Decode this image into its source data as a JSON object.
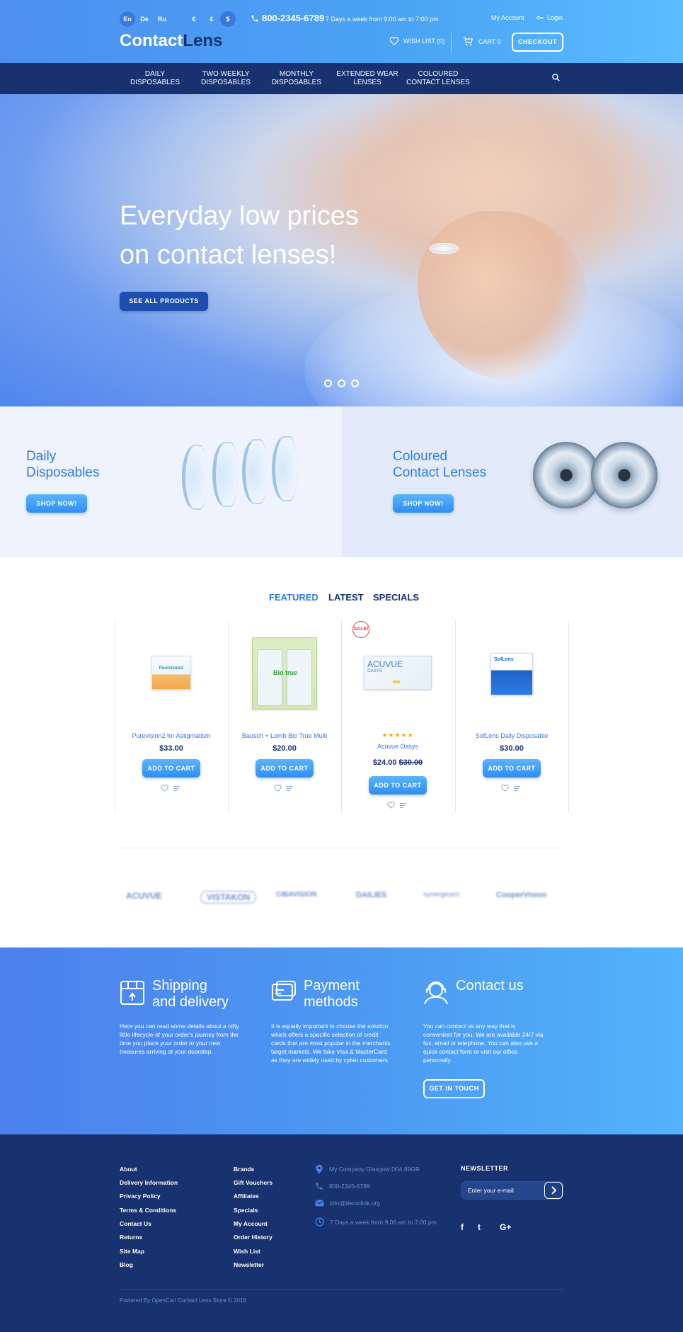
{
  "header": {
    "languages": [
      {
        "label": "En",
        "active": true
      },
      {
        "label": "De",
        "active": false
      },
      {
        "label": "Ru",
        "active": false
      }
    ],
    "currencies": [
      {
        "label": "€",
        "active": false
      },
      {
        "label": "£",
        "active": false
      },
      {
        "label": "$",
        "active": true
      }
    ],
    "phone": "800-2345-6789",
    "hours": "7 Days a week from 9:00 am to 7:00 pm",
    "my_account": "My Account",
    "login": "Login",
    "logo_part1": "Contact",
    "logo_part2": "Lens",
    "wishlist": "WISH LIST (0)",
    "cart": "CART 0",
    "checkout": "CHECKOUT"
  },
  "nav": {
    "items": [
      {
        "line1": "DAILY",
        "line2": "DISPOSABLES"
      },
      {
        "line1": "TWO WEEKLY",
        "line2": "DISPOSABLES"
      },
      {
        "line1": "MONTHLY",
        "line2": "DISPOSABLES"
      },
      {
        "line1": "EXTENDED WEAR",
        "line2": "LENSES"
      },
      {
        "line1": "COLOURED",
        "line2": "CONTACT LENSES"
      }
    ]
  },
  "hero": {
    "line1": "Everyday low prices",
    "line2": "on contact lenses!",
    "button": "SEE ALL PRODUCTS",
    "slides": 3,
    "active_slide": 1
  },
  "promos": [
    {
      "line1": "Daily",
      "line2": "Disposables",
      "button": "SHOP NOW!"
    },
    {
      "line1": "Coloured",
      "line2": "Contact Lenses",
      "button": "SHOP NOW!"
    }
  ],
  "tabs": [
    {
      "label": "FEATURED",
      "active": true
    },
    {
      "label": "LATEST",
      "active": false
    },
    {
      "label": "SPECIALS",
      "active": false
    }
  ],
  "products": [
    {
      "name": "Purevision2 for Astigmatism",
      "price": "$33.00",
      "old_price": "",
      "rating": 0,
      "sale": false,
      "button": "ADD TO CART"
    },
    {
      "name": "Bausch + Lomb Bio True Multi",
      "price": "$20.00",
      "old_price": "",
      "rating": 0,
      "sale": false,
      "button": "ADD TO CART"
    },
    {
      "name": "Acuvue Oasys",
      "price": "$24.00",
      "old_price": "$30.00",
      "rating": 5,
      "sale": true,
      "button": "ADD TO CART"
    },
    {
      "name": "SofLens Daily Disposable",
      "price": "$30.00",
      "old_price": "",
      "rating": 0,
      "sale": false,
      "button": "ADD TO CART"
    }
  ],
  "product_art": {
    "purevision": "PureVision2",
    "biotrue": "Bio true",
    "acuvue": "ACUVUE",
    "acuvue_sub": "OASYS",
    "soflens": "SofLens"
  },
  "sale_badge": "SALE!",
  "stars": "★★★★★",
  "brands": [
    "ACUVUE",
    "VISTAKON",
    "CIBAVISION",
    "DAILIES",
    "synergeyes",
    "CooperVision"
  ],
  "info": [
    {
      "line1": "Shipping",
      "line2": "and delivery",
      "text": "Here you can read some details about a nifty little lifecycle of your order's journey from the time you place your order to your new treasures arriving at your doorstep."
    },
    {
      "line1": "Payment",
      "line2": "methods",
      "text": "It is equally important to choose the solution which offers a specific selection of credit cards that are most popular in the merchants target markets. We take Visa & MasterCard as they are widely used by cyber customers."
    },
    {
      "line1": "Contact us",
      "line2": "",
      "text": "You can contact us any way that is convenient for you. We are available 24/7 via fax, email or telephone. You can also use a quick contact form or visit our office personally."
    }
  ],
  "get_in_touch": "GET IN TOUCH",
  "footer": {
    "col1": [
      "About",
      "Delivery Information",
      "Privacy Policy",
      "Terms & Conditions",
      "Contact Us",
      "Returns",
      "Site Map",
      "Blog"
    ],
    "col2": [
      "Brands",
      "Gift Vouchers",
      "Affiliates",
      "Specials",
      "My Account",
      "Order History",
      "Wish List",
      "Newsletter"
    ],
    "address": "My Company Glasgow D04 89GR",
    "phone": "800-2345-6789",
    "email": "info@demolink.org",
    "hours": "7 Days a week from 9:00 am to 7:00 pm",
    "newsletter_title": "NEWSLETTER",
    "newsletter_placeholder": "Enter your e-mail",
    "social": [
      "f",
      "t",
      "G+"
    ],
    "copyright": "Powered By OpenCart Contact Lens Store © 2016"
  },
  "colors": {
    "accent": "#2f7ae5",
    "navy": "#17326e",
    "header_blue": "#4aa4f4",
    "sale_red": "#e84343",
    "star": "#f5a623"
  }
}
